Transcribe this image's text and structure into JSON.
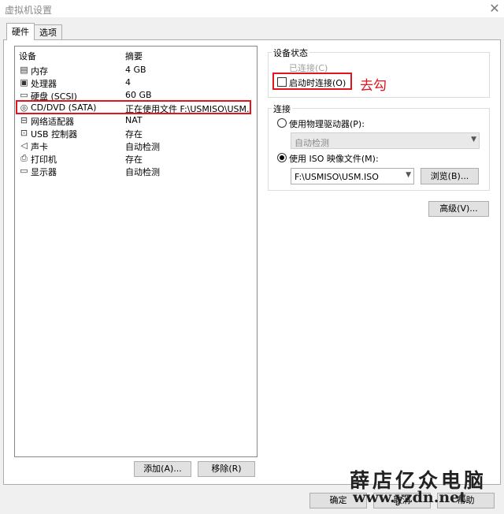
{
  "window": {
    "title": "虚拟机设置"
  },
  "tabs": [
    {
      "label": "硬件"
    },
    {
      "label": "选项"
    }
  ],
  "device_list": {
    "headers": {
      "device": "设备",
      "summary": "摘要"
    },
    "rows": [
      {
        "icon": "memory-icon",
        "name": "内存",
        "summary": "4 GB"
      },
      {
        "icon": "processor-icon",
        "name": "处理器",
        "summary": "4"
      },
      {
        "icon": "hard-disk-icon",
        "name": "硬盘 (SCSI)",
        "summary": "60 GB"
      },
      {
        "icon": "cd-dvd-icon",
        "name": "CD/DVD (SATA)",
        "summary": "正在使用文件 F:\\USMISO\\USM."
      },
      {
        "icon": "network-adapter-icon",
        "name": "网络适配器",
        "summary": "NAT"
      },
      {
        "icon": "usb-icon",
        "name": "USB 控制器",
        "summary": "存在"
      },
      {
        "icon": "sound-card-icon",
        "name": "声卡",
        "summary": "自动检测"
      },
      {
        "icon": "printer-icon",
        "name": "打印机",
        "summary": "存在"
      },
      {
        "icon": "display-icon",
        "name": "显示器",
        "summary": "自动检测"
      }
    ]
  },
  "list_buttons": {
    "add": "添加(A)...",
    "remove": "移除(R)"
  },
  "device_status": {
    "title": "设备状态",
    "connected": {
      "label": "已连接(C)",
      "checked": false,
      "enabled": false
    },
    "connect_at_power_on": {
      "label": "启动时连接(O)",
      "checked": false
    }
  },
  "annotation": "去勾",
  "connection": {
    "title": "连接",
    "physical_drive": {
      "label": "使用物理驱动器(P):",
      "selected": false
    },
    "physical_drive_select": "自动检测",
    "iso": {
      "label": "使用 ISO 映像文件(M):",
      "selected": true
    },
    "iso_path": "F:\\USMISO\\USM.ISO",
    "browse": "浏览(B)..."
  },
  "advanced_button": "高级(V)...",
  "footer_buttons": {
    "ok": "确定",
    "cancel": "取消",
    "help": "帮助"
  },
  "watermark": {
    "brand": "薛店亿众电脑",
    "url": "www.yzdn.net"
  },
  "colors": {
    "highlight_red": "#e0151f",
    "window_bg": "#f0f0f0",
    "list_border": "#828790"
  }
}
